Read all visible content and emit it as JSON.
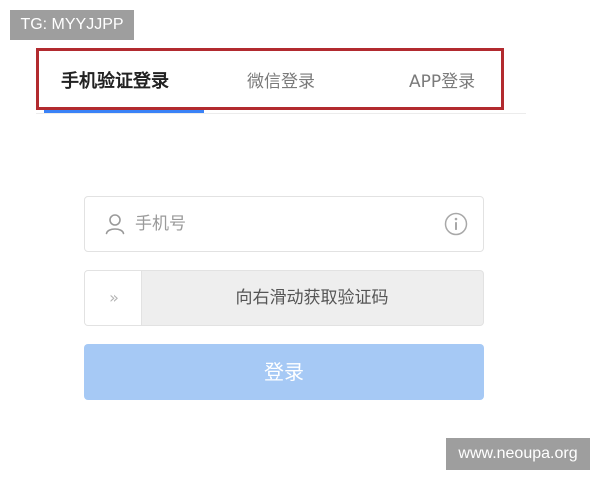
{
  "watermarks": {
    "top": "TG: MYYJJPP",
    "bottom": "www.neoupa.org"
  },
  "tabs": [
    {
      "label": "手机验证登录",
      "active": true
    },
    {
      "label": "微信登录",
      "active": false
    },
    {
      "label": "APP登录",
      "active": false
    }
  ],
  "phone_field": {
    "placeholder": "手机号",
    "value": "",
    "leading_icon": "user-icon",
    "trailing_icon": "info-icon"
  },
  "slider": {
    "handle_glyph": "»",
    "label": "向右滑动获取验证码"
  },
  "login_button": {
    "label": "登录"
  },
  "colors": {
    "highlight_border": "#b22a2f",
    "active_tab_underline": "#3a82f7",
    "login_button_bg": "#a6c9f5"
  }
}
